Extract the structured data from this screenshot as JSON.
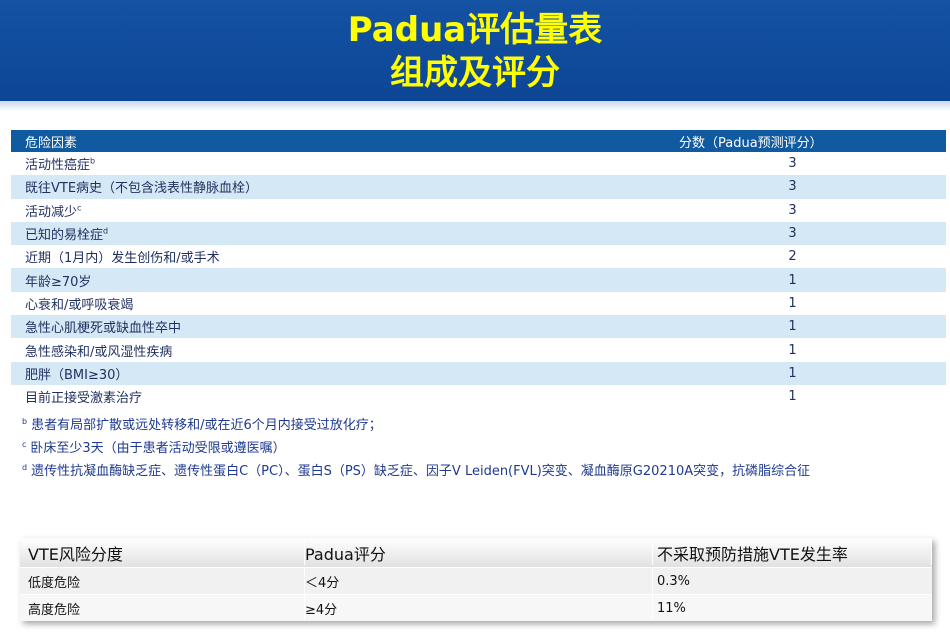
{
  "title": {
    "line1": "Padua评估量表",
    "line2": "组成及评分"
  },
  "risk_table": {
    "headers": {
      "factor": "危险因素",
      "score": "分数（Padua预测评分）"
    },
    "rows": [
      {
        "factor": "活动性癌症",
        "sup": "b",
        "score": "3"
      },
      {
        "factor": "既往VTE病史（不包含浅表性静脉血栓）",
        "sup": "",
        "score": "3"
      },
      {
        "factor": "活动减少",
        "sup": "c",
        "score": "3"
      },
      {
        "factor": "已知的易栓症",
        "sup": "d",
        "score": "3"
      },
      {
        "factor": "近期（1月内）发生创伤和/或手术",
        "sup": "",
        "score": "2"
      },
      {
        "factor": "年龄≥70岁",
        "sup": "",
        "score": "1"
      },
      {
        "factor": "心衰和/或呼吸衰竭",
        "sup": "",
        "score": "1"
      },
      {
        "factor": "急性心肌梗死或缺血性卒中",
        "sup": "",
        "score": "1"
      },
      {
        "factor": "急性感染和/或风湿性疾病",
        "sup": "",
        "score": "1"
      },
      {
        "factor": "肥胖（BMI≥30）",
        "sup": "",
        "score": "1"
      },
      {
        "factor": "目前正接受激素治疗",
        "sup": "",
        "score": "1"
      }
    ]
  },
  "notes": [
    {
      "mark": "b",
      "text": "患者有局部扩散或远处转移和/或在近6个月内接受过放化疗；"
    },
    {
      "mark": "c",
      "text": "卧床至少3天（由于患者活动受限或遵医嘱）"
    },
    {
      "mark": "d",
      "text": "遗传性抗凝血酶缺乏症、遗传性蛋白C（PC）、蛋白S（PS）缺乏症、因子V Leiden(FVL)突变、凝血酶原G20210A突变，抗磷脂综合征"
    }
  ],
  "vte_table": {
    "headers": {
      "level": "VTE风险分度",
      "score": "Padua评分",
      "rate": "不采取预防措施VTE发生率"
    },
    "rows": [
      {
        "level": "低度危险",
        "score": "＜4分",
        "rate": "0.3%"
      },
      {
        "level": "高度危险",
        "score": "≥4分",
        "rate": "11%"
      }
    ]
  },
  "colors": {
    "header_bg": "#1452a3",
    "title_text": "#ffff00",
    "table_header_bg": "#0f5aa0",
    "row_alt_bg": "#d4e8f5",
    "body_text": "#1f2f5f",
    "note_text": "#1f3a8f"
  }
}
